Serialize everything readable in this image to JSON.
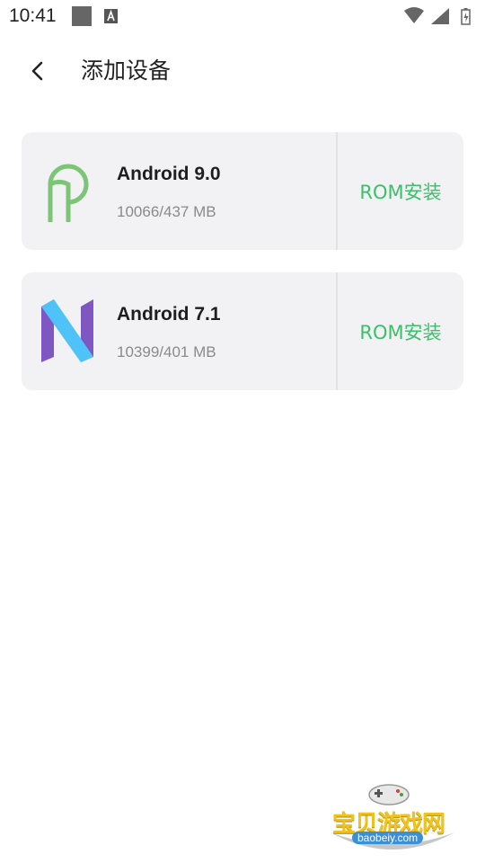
{
  "status_bar": {
    "time": "10:41"
  },
  "header": {
    "title": "添加设备"
  },
  "devices": [
    {
      "name": "Android 9.0",
      "meta": "10066/437 MB",
      "action": "ROM安装",
      "logo": "android-pie-logo"
    },
    {
      "name": "Android 7.1",
      "meta": "10399/401 MB",
      "action": "ROM安装",
      "logo": "android-nougat-logo"
    }
  ],
  "watermark": {
    "text": "宝贝游戏网",
    "url": "baobeiy.com"
  },
  "colors": {
    "accent_green": "#3cbf6a",
    "card_bg": "#f2f2f4",
    "pie_green": "#7cc576",
    "nougat_blue": "#4fc3f7",
    "nougat_purple": "#7e57c2"
  }
}
